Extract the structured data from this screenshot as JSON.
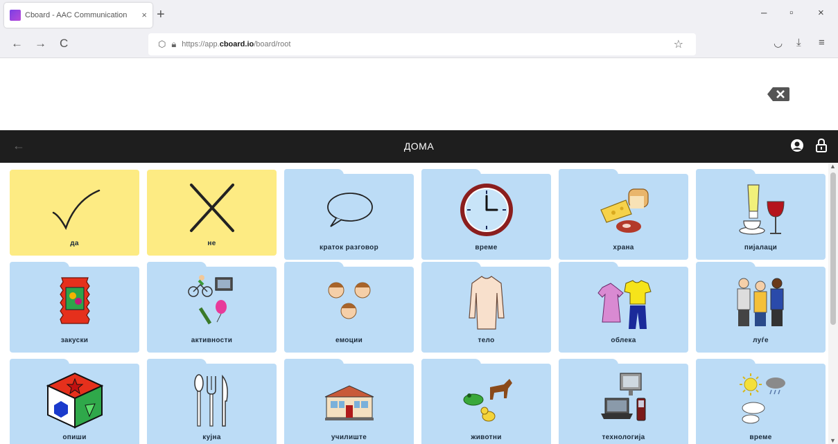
{
  "browser": {
    "tab_title": "Cboard - AAC Communication",
    "tab_close": "×",
    "new_tab": "+",
    "url_prefix": "https://app.",
    "url_domain": "cboard.io",
    "url_path": "/board/root",
    "nav": {
      "back": "←",
      "forward": "→",
      "reload": "C"
    },
    "window": {
      "minimize": "–",
      "maximize": "▫",
      "close": "×"
    }
  },
  "header": {
    "title": "ДОМА",
    "back_arrow": "←"
  },
  "tiles": [
    {
      "label": "да",
      "type": "button",
      "icon": "checkmark-icon"
    },
    {
      "label": "не",
      "type": "button",
      "icon": "cross-icon"
    },
    {
      "label": "краток разговор",
      "type": "folder",
      "icon": "speech-bubble-icon"
    },
    {
      "label": "време",
      "type": "folder",
      "icon": "clock-icon"
    },
    {
      "label": "храна",
      "type": "folder",
      "icon": "food-icon"
    },
    {
      "label": "пијалаци",
      "type": "folder",
      "icon": "drinks-icon"
    },
    {
      "label": "закуски",
      "type": "folder",
      "icon": "snack-bag-icon"
    },
    {
      "label": "активности",
      "type": "folder",
      "icon": "activities-icon"
    },
    {
      "label": "емоции",
      "type": "folder",
      "icon": "faces-icon"
    },
    {
      "label": "тело",
      "type": "folder",
      "icon": "body-icon"
    },
    {
      "label": "облека",
      "type": "folder",
      "icon": "clothes-icon"
    },
    {
      "label": "луѓе",
      "type": "folder",
      "icon": "people-icon"
    },
    {
      "label": "опиши",
      "type": "folder",
      "icon": "shape-cube-icon"
    },
    {
      "label": "кујна",
      "type": "folder",
      "icon": "cutlery-icon"
    },
    {
      "label": "училиште",
      "type": "folder",
      "icon": "school-icon"
    },
    {
      "label": "животни",
      "type": "folder",
      "icon": "animals-icon"
    },
    {
      "label": "технологија",
      "type": "folder",
      "icon": "computer-icon"
    },
    {
      "label": "време",
      "type": "folder",
      "icon": "weather-icon"
    }
  ],
  "colors": {
    "button_tile": "#fdeb83",
    "folder_tile": "#bcdcf6",
    "header_bg": "#1e1e1e"
  }
}
